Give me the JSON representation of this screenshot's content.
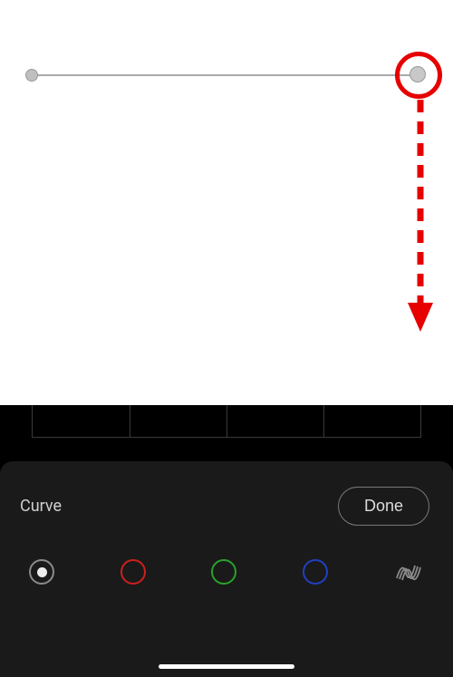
{
  "panel": {
    "title": "Curve",
    "done_label": "Done"
  },
  "channels": {
    "luma_name": "luminance-channel",
    "red_name": "red-channel",
    "green_name": "green-channel",
    "blue_name": "blue-channel",
    "parametric_name": "parametric-curve"
  },
  "annotation": {
    "color": "#e60000",
    "description": "drag handle down"
  }
}
